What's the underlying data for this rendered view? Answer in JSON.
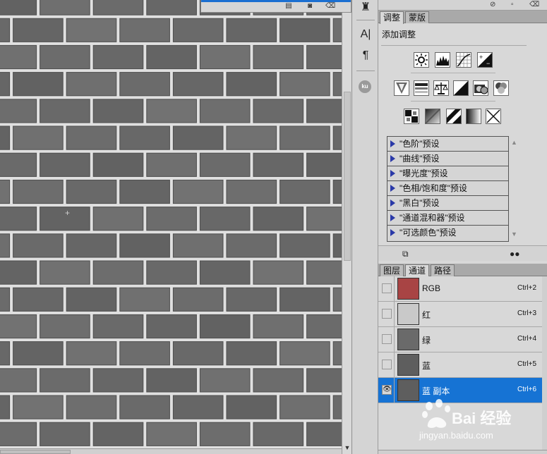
{
  "top_panel": {
    "icons": [
      "new-doc-icon",
      "camera-icon",
      "trash-icon"
    ]
  },
  "tool_strip": {
    "items": [
      "stamp-icon",
      "text-panel-icon",
      "paragraph-icon",
      "kuler-icon"
    ],
    "kuler_label": "ku"
  },
  "adjustments": {
    "tabs": [
      {
        "label": "调整",
        "active": true
      },
      {
        "label": "蒙版",
        "active": false
      }
    ],
    "title": "添加调整",
    "row1": [
      "brightness-contrast-icon",
      "levels-icon",
      "curves-icon",
      "exposure-icon"
    ],
    "row2": [
      "vibrance-icon",
      "hue-saturation-icon",
      "color-balance-icon",
      "black-white-icon",
      "photo-filter-icon",
      "channel-mixer-icon"
    ],
    "row3": [
      "invert-icon",
      "posterize-icon",
      "threshold-icon",
      "gradient-map-icon",
      "selective-color-icon"
    ],
    "presets": [
      "\"色阶\"预设",
      "\"曲线\"预设",
      "\"曝光度\"预设",
      "\"色相/饱和度\"预设",
      "\"黑白\"预设",
      "\"通道混和器\"预设",
      "\"可选颜色\"预设"
    ]
  },
  "layers_panel": {
    "tabs": [
      {
        "label": "图层",
        "active": false
      },
      {
        "label": "通道",
        "active": true
      },
      {
        "label": "路径",
        "active": false
      }
    ],
    "channels": [
      {
        "name": "RGB",
        "shortcut": "Ctrl+2",
        "visible": false,
        "selected": false,
        "thumb_color": "#a84444"
      },
      {
        "name": "红",
        "shortcut": "Ctrl+3",
        "visible": false,
        "selected": false,
        "thumb_color": "#c9c9c9"
      },
      {
        "name": "绿",
        "shortcut": "Ctrl+4",
        "visible": false,
        "selected": false,
        "thumb_color": "#6a6a6a"
      },
      {
        "name": "蓝",
        "shortcut": "Ctrl+5",
        "visible": false,
        "selected": false,
        "thumb_color": "#5e5e5e"
      },
      {
        "name": "蓝 副本",
        "shortcut": "Ctrl+6",
        "visible": true,
        "selected": true,
        "thumb_color": "#5e5e5e"
      }
    ]
  },
  "watermark": {
    "brand": "Bai 经验",
    "url": "jingyan.baidu.com"
  },
  "colors": {
    "selection_blue": "#1673d4",
    "preset_triangle": "#2a39a8",
    "brick_fill": "#6a6a6a",
    "mortar": "#e2e2e2"
  }
}
